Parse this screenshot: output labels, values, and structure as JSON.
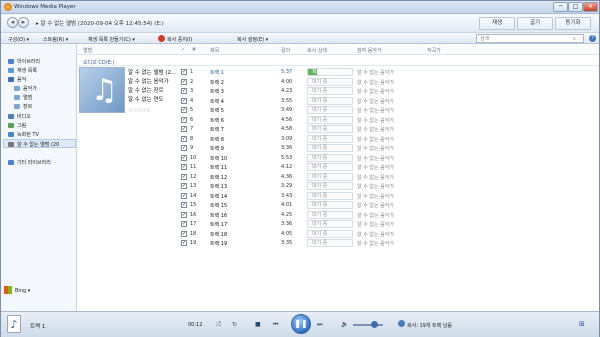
{
  "window": {
    "title": "Windows Media Player",
    "min": "─",
    "max": "□",
    "close": "✕"
  },
  "nav": {
    "back": "◂",
    "forward": "▸",
    "breadcrumb": "▸ 알 수 없는 앨범 (2020-09-04 오후 12:45:54) (E:)",
    "tabs": [
      "재생",
      "굽기",
      "동기화"
    ]
  },
  "toolbar": {
    "organize": "구성(O) ▾",
    "stream": "스트림(R) ▾",
    "create_playlist": "재생 목록 만들기(C) ▾",
    "stop_rip": "복사 중지(I)",
    "rip_settings": "복사 설정(E) ▾",
    "search_placeholder": "검색"
  },
  "sidebar": {
    "items": [
      {
        "label": "라이브러리",
        "color": "#4a86c9"
      },
      {
        "label": "재생 목록",
        "color": "#5b9bd5"
      },
      {
        "label": "음악",
        "color": "#3d6fb3"
      },
      {
        "label": "음악가",
        "color": "#7aa6d6"
      },
      {
        "label": "앨범",
        "color": "#7aa6d6"
      },
      {
        "label": "장르",
        "color": "#7aa6d6"
      },
      {
        "label": "비디오",
        "color": "#4f7fb8"
      },
      {
        "label": "그림",
        "color": "#5fa05c"
      },
      {
        "label": "녹화된 TV",
        "color": "#4a86c9"
      },
      {
        "label": "알 수 없는 앨범 (20",
        "color": "#777777"
      },
      {
        "label": "기타 라이브러리",
        "color": "#4a86c9"
      }
    ],
    "bing": "Bing ▾"
  },
  "columns": {
    "album": "앨범",
    "check": "✓",
    "num": "#",
    "title": "제목",
    "length": "길이",
    "rip_status": "복사 상태",
    "contrib_artist": "참여 음악가",
    "composer": "작곡가"
  },
  "album": {
    "label": "오디오 CD(E:)",
    "info": [
      "알 수 없는 앨범 (2...",
      "알 수 없는 음악가",
      "알 수 없는 장르",
      "알 수 없는 연도"
    ],
    "stars": "☆☆☆☆☆",
    "note": "♫"
  },
  "tracks": [
    {
      "n": "1",
      "title": "트랙 1",
      "len": "5:37",
      "status": "복사 중(20%)",
      "progress": 0.2,
      "artist": "알 수 없는 음악가"
    },
    {
      "n": "2",
      "title": "트랙 2",
      "len": "4:00",
      "status": "대기 중",
      "progress": 0,
      "artist": "알 수 없는 음악가"
    },
    {
      "n": "3",
      "title": "트랙 3",
      "len": "4:23",
      "status": "대기 중",
      "progress": 0,
      "artist": "알 수 없는 음악가"
    },
    {
      "n": "4",
      "title": "트랙 4",
      "len": "3:55",
      "status": "대기 중",
      "progress": 0,
      "artist": "알 수 없는 음악가"
    },
    {
      "n": "5",
      "title": "트랙 5",
      "len": "3:49",
      "status": "대기 중",
      "progress": 0,
      "artist": "알 수 없는 음악가"
    },
    {
      "n": "6",
      "title": "트랙 6",
      "len": "4:56",
      "status": "대기 중",
      "progress": 0,
      "artist": "알 수 없는 음악가"
    },
    {
      "n": "7",
      "title": "트랙 7",
      "len": "4:58",
      "status": "대기 중",
      "progress": 0,
      "artist": "알 수 없는 음악가"
    },
    {
      "n": "8",
      "title": "트랙 8",
      "len": "3:09",
      "status": "대기 중",
      "progress": 0,
      "artist": "알 수 없는 음악가"
    },
    {
      "n": "9",
      "title": "트랙 9",
      "len": "3:36",
      "status": "대기 중",
      "progress": 0,
      "artist": "알 수 없는 음악가"
    },
    {
      "n": "10",
      "title": "트랙 10",
      "len": "5:53",
      "status": "대기 중",
      "progress": 0,
      "artist": "알 수 없는 음악가"
    },
    {
      "n": "11",
      "title": "트랙 11",
      "len": "4:12",
      "status": "대기 중",
      "progress": 0,
      "artist": "알 수 없는 음악가"
    },
    {
      "n": "12",
      "title": "트랙 12",
      "len": "4:36",
      "status": "대기 중",
      "progress": 0,
      "artist": "알 수 없는 음악가"
    },
    {
      "n": "13",
      "title": "트랙 13",
      "len": "3:29",
      "status": "대기 중",
      "progress": 0,
      "artist": "알 수 없는 음악가"
    },
    {
      "n": "14",
      "title": "트랙 14",
      "len": "3:43",
      "status": "대기 중",
      "progress": 0,
      "artist": "알 수 없는 음악가"
    },
    {
      "n": "15",
      "title": "트랙 15",
      "len": "4:01",
      "status": "대기 중",
      "progress": 0,
      "artist": "알 수 없는 음악가"
    },
    {
      "n": "16",
      "title": "트랙 16",
      "len": "4:25",
      "status": "대기 중",
      "progress": 0,
      "artist": "알 수 없는 음악가"
    },
    {
      "n": "17",
      "title": "트랙 17",
      "len": "3:36",
      "status": "대기 중",
      "progress": 0,
      "artist": "알 수 없는 음악가"
    },
    {
      "n": "18",
      "title": "트랙 18",
      "len": "4:05",
      "status": "대기 중",
      "progress": 0,
      "artist": "알 수 없는 음악가"
    },
    {
      "n": "19",
      "title": "트랙 19",
      "len": "3:35",
      "status": "대기 중",
      "progress": 0,
      "artist": "알 수 없는 음악가"
    }
  ],
  "player": {
    "now_playing": "트랙 1",
    "time": "00:12",
    "shuffle": "⤮",
    "repeat": "↻",
    "stop": "■",
    "prev": "⏮",
    "play": "❚❚",
    "next": "⏭",
    "mute": "🔈",
    "volume": 0.6,
    "burn_info": "복사: 19개 트랙 남음",
    "switch_view": "⊞"
  }
}
